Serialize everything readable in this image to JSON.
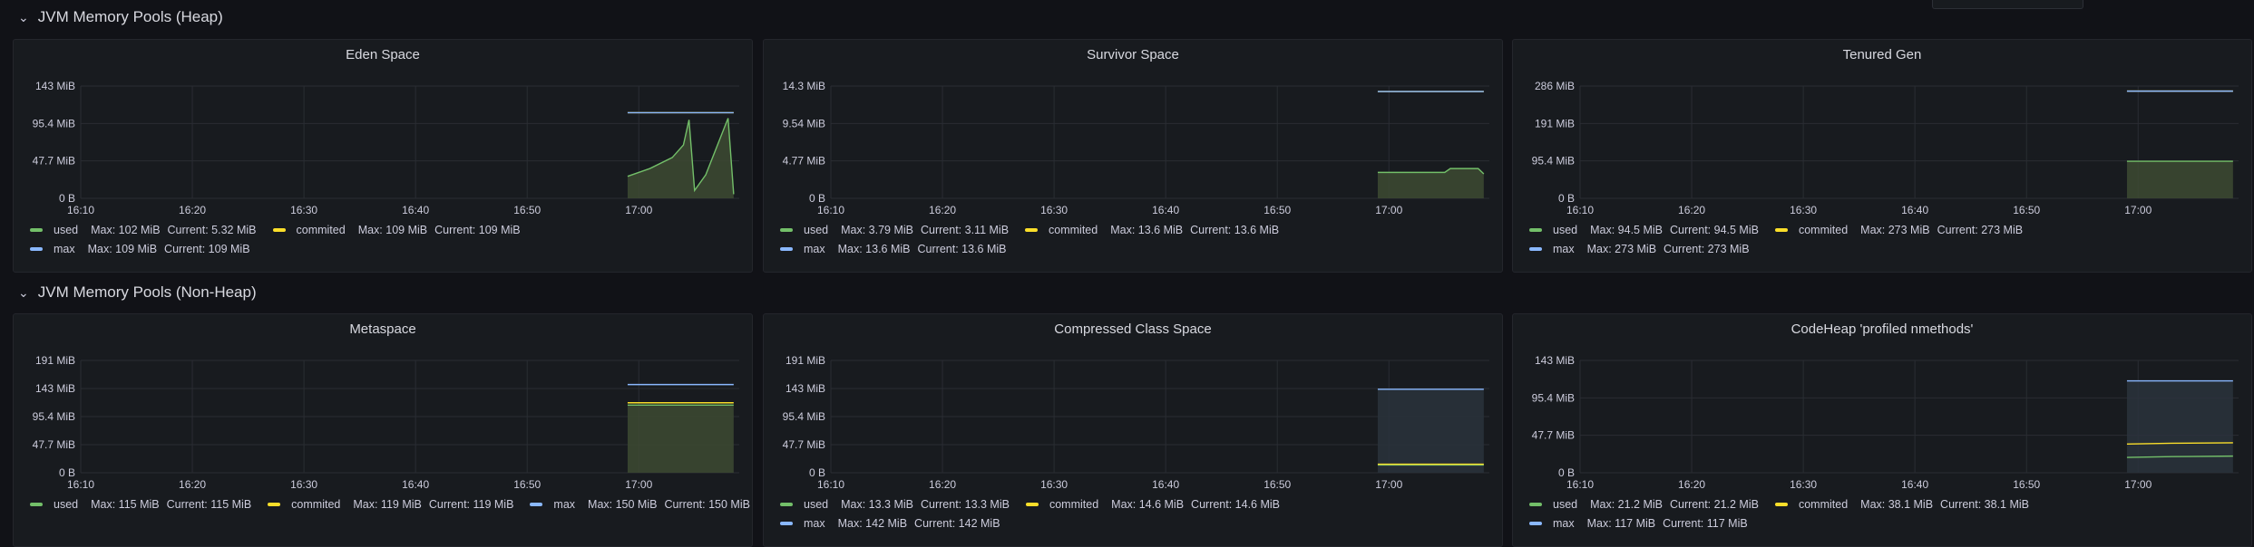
{
  "colors": {
    "used": "#73bf69",
    "commited": "#fade2a",
    "max": "#8ab8ff",
    "used_area": "#3d4a33",
    "max_area": "#2a323c"
  },
  "rows": [
    {
      "title": "JVM Memory Pools (Heap)",
      "chevron_icon": "chevron-down-icon"
    },
    {
      "title": "JVM Memory Pools (Non-Heap)",
      "chevron_icon": "chevron-down-icon"
    }
  ],
  "panels": [
    {
      "title": "Eden Space",
      "legend": [
        {
          "name": "used",
          "max": "Max: 102 MiB",
          "current": "Current: 5.32 MiB",
          "color": "used"
        },
        {
          "name": "commited",
          "max": "Max: 109 MiB",
          "current": "Current: 109 MiB",
          "color": "commited"
        },
        {
          "name": "max",
          "max": "Max: 109 MiB",
          "current": "Current: 109 MiB",
          "color": "max"
        }
      ],
      "legend_break_after": 2
    },
    {
      "title": "Survivor Space",
      "legend": [
        {
          "name": "used",
          "max": "Max: 3.79 MiB",
          "current": "Current: 3.11 MiB",
          "color": "used"
        },
        {
          "name": "commited",
          "max": "Max: 13.6 MiB",
          "current": "Current: 13.6 MiB",
          "color": "commited"
        },
        {
          "name": "max",
          "max": "Max: 13.6 MiB",
          "current": "Current: 13.6 MiB",
          "color": "max"
        }
      ],
      "legend_break_after": 2
    },
    {
      "title": "Tenured Gen",
      "legend": [
        {
          "name": "used",
          "max": "Max: 94.5 MiB",
          "current": "Current: 94.5 MiB",
          "color": "used"
        },
        {
          "name": "commited",
          "max": "Max: 273 MiB",
          "current": "Current: 273 MiB",
          "color": "commited"
        },
        {
          "name": "max",
          "max": "Max: 273 MiB",
          "current": "Current: 273 MiB",
          "color": "max"
        }
      ],
      "legend_break_after": 2
    },
    {
      "title": "Metaspace",
      "legend": [
        {
          "name": "used",
          "max": "Max: 115 MiB",
          "current": "Current: 115 MiB",
          "color": "used"
        },
        {
          "name": "commited",
          "max": "Max: 119 MiB",
          "current": "Current: 119 MiB",
          "color": "commited"
        },
        {
          "name": "max",
          "max": "Max: 150 MiB",
          "current": "Current: 150 MiB",
          "color": "max"
        }
      ],
      "legend_break_after": 3
    },
    {
      "title": "Compressed Class Space",
      "legend": [
        {
          "name": "used",
          "max": "Max: 13.3 MiB",
          "current": "Current: 13.3 MiB",
          "color": "used"
        },
        {
          "name": "commited",
          "max": "Max: 14.6 MiB",
          "current": "Current: 14.6 MiB",
          "color": "commited"
        },
        {
          "name": "max",
          "max": "Max: 142 MiB",
          "current": "Current: 142 MiB",
          "color": "max"
        }
      ],
      "legend_break_after": 2
    },
    {
      "title": "CodeHeap 'profiled nmethods'",
      "legend": [
        {
          "name": "used",
          "max": "Max: 21.2 MiB",
          "current": "Current: 21.2 MiB",
          "color": "used"
        },
        {
          "name": "commited",
          "max": "Max: 38.1 MiB",
          "current": "Current: 38.1 MiB",
          "color": "commited"
        },
        {
          "name": "max",
          "max": "Max: 117 MiB",
          "current": "Current: 117 MiB",
          "color": "max"
        }
      ],
      "legend_break_after": 2
    }
  ],
  "chart_data": [
    {
      "type": "line",
      "title": "Eden Space",
      "x_unit": "time",
      "xticks": [
        "16:10",
        "16:20",
        "16:30",
        "16:40",
        "16:50",
        "17:00"
      ],
      "yticks": [
        "0 B",
        "47.7 MiB",
        "95.4 MiB",
        "143 MiB"
      ],
      "ylim": [
        0,
        143
      ],
      "x_range": [
        "16:10",
        "17:09"
      ],
      "grid": true,
      "legend_placement": "bottom",
      "series": [
        {
          "name": "used",
          "color": "used",
          "fill": true,
          "x": [
            "16:59",
            "17:01",
            "17:03",
            "17:04",
            "17:04.5",
            "17:05",
            "17:06",
            "17:08",
            "17:08.5"
          ],
          "y": [
            28,
            38,
            52,
            68,
            100,
            10,
            30,
            102,
            5.32
          ]
        },
        {
          "name": "commited",
          "color": "commited",
          "fill": false,
          "x": [
            "16:59",
            "17:08.5"
          ],
          "y": [
            109,
            109
          ]
        },
        {
          "name": "max",
          "color": "max",
          "fill": false,
          "x": [
            "16:59",
            "17:08.5"
          ],
          "y": [
            109,
            109
          ]
        }
      ]
    },
    {
      "type": "line",
      "title": "Survivor Space",
      "x_unit": "time",
      "xticks": [
        "16:10",
        "16:20",
        "16:30",
        "16:40",
        "16:50",
        "17:00"
      ],
      "yticks": [
        "0 B",
        "4.77 MiB",
        "9.54 MiB",
        "14.3 MiB"
      ],
      "ylim": [
        0,
        14.3
      ],
      "x_range": [
        "16:10",
        "17:09"
      ],
      "grid": true,
      "legend_placement": "bottom",
      "series": [
        {
          "name": "used",
          "color": "used",
          "fill": true,
          "x": [
            "16:59",
            "17:05",
            "17:05.5",
            "17:08",
            "17:08.5"
          ],
          "y": [
            3.3,
            3.3,
            3.79,
            3.79,
            3.11
          ]
        },
        {
          "name": "commited",
          "color": "commited",
          "fill": false,
          "x": [
            "16:59",
            "17:08.5"
          ],
          "y": [
            13.6,
            13.6
          ]
        },
        {
          "name": "max",
          "color": "max",
          "fill": false,
          "x": [
            "16:59",
            "17:08.5"
          ],
          "y": [
            13.6,
            13.6
          ]
        }
      ]
    },
    {
      "type": "line",
      "title": "Tenured Gen",
      "x_unit": "time",
      "xticks": [
        "16:10",
        "16:20",
        "16:30",
        "16:40",
        "16:50",
        "17:00"
      ],
      "yticks": [
        "0 B",
        "95.4 MiB",
        "191 MiB",
        "286 MiB"
      ],
      "ylim": [
        0,
        286
      ],
      "x_range": [
        "16:10",
        "17:09"
      ],
      "grid": true,
      "legend_placement": "bottom",
      "series": [
        {
          "name": "used",
          "color": "used",
          "fill": true,
          "x": [
            "16:59",
            "17:08.5"
          ],
          "y": [
            94.5,
            94.5
          ]
        },
        {
          "name": "commited",
          "color": "commited",
          "fill": false,
          "x": [
            "16:59",
            "17:08.5"
          ],
          "y": [
            273,
            273
          ]
        },
        {
          "name": "max",
          "color": "max",
          "fill": false,
          "x": [
            "16:59",
            "17:08.5"
          ],
          "y": [
            273,
            273
          ]
        }
      ]
    },
    {
      "type": "line",
      "title": "Metaspace",
      "x_unit": "time",
      "xticks": [
        "16:10",
        "16:20",
        "16:30",
        "16:40",
        "16:50",
        "17:00"
      ],
      "yticks": [
        "0 B",
        "47.7 MiB",
        "95.4 MiB",
        "143 MiB",
        "191 MiB"
      ],
      "ylim": [
        0,
        191
      ],
      "x_range": [
        "16:10",
        "17:09"
      ],
      "grid": true,
      "legend_placement": "bottom",
      "series": [
        {
          "name": "used",
          "color": "used",
          "fill": true,
          "x": [
            "16:59",
            "17:08.5"
          ],
          "y": [
            115,
            115
          ]
        },
        {
          "name": "commited",
          "color": "commited",
          "fill": false,
          "x": [
            "16:59",
            "17:08.5"
          ],
          "y": [
            119,
            119
          ]
        },
        {
          "name": "max",
          "color": "max",
          "fill": false,
          "x": [
            "16:59",
            "17:08.5"
          ],
          "y": [
            150,
            150
          ]
        }
      ]
    },
    {
      "type": "line",
      "title": "Compressed Class Space",
      "x_unit": "time",
      "xticks": [
        "16:10",
        "16:20",
        "16:30",
        "16:40",
        "16:50",
        "17:00"
      ],
      "yticks": [
        "0 B",
        "47.7 MiB",
        "95.4 MiB",
        "143 MiB",
        "191 MiB"
      ],
      "ylim": [
        0,
        191
      ],
      "x_range": [
        "16:10",
        "17:09"
      ],
      "grid": true,
      "legend_placement": "bottom",
      "series": [
        {
          "name": "used",
          "color": "used",
          "fill": false,
          "x": [
            "16:59",
            "17:08.5"
          ],
          "y": [
            13.3,
            13.3
          ]
        },
        {
          "name": "commited",
          "color": "commited",
          "fill": false,
          "x": [
            "16:59",
            "17:08.5"
          ],
          "y": [
            14.6,
            14.6
          ]
        },
        {
          "name": "max",
          "color": "max",
          "fill": true,
          "x": [
            "16:59",
            "17:08.5"
          ],
          "y": [
            142,
            142
          ]
        }
      ]
    },
    {
      "type": "line",
      "title": "CodeHeap 'profiled nmethods'",
      "x_unit": "time",
      "xticks": [
        "16:10",
        "16:20",
        "16:30",
        "16:40",
        "16:50",
        "17:00"
      ],
      "yticks": [
        "0 B",
        "47.7 MiB",
        "95.4 MiB",
        "143 MiB"
      ],
      "ylim": [
        0,
        143
      ],
      "x_range": [
        "16:10",
        "17:09"
      ],
      "grid": true,
      "legend_placement": "bottom",
      "series": [
        {
          "name": "used",
          "color": "used",
          "fill": false,
          "x": [
            "16:59",
            "17:03",
            "17:08.5"
          ],
          "y": [
            19.5,
            20.5,
            21.2
          ]
        },
        {
          "name": "commited",
          "color": "commited",
          "fill": false,
          "x": [
            "16:59",
            "17:03",
            "17:08.5"
          ],
          "y": [
            36.5,
            37.5,
            38.1
          ]
        },
        {
          "name": "max",
          "color": "max",
          "fill": true,
          "x": [
            "16:59",
            "17:08.5"
          ],
          "y": [
            117,
            117
          ]
        }
      ]
    }
  ]
}
